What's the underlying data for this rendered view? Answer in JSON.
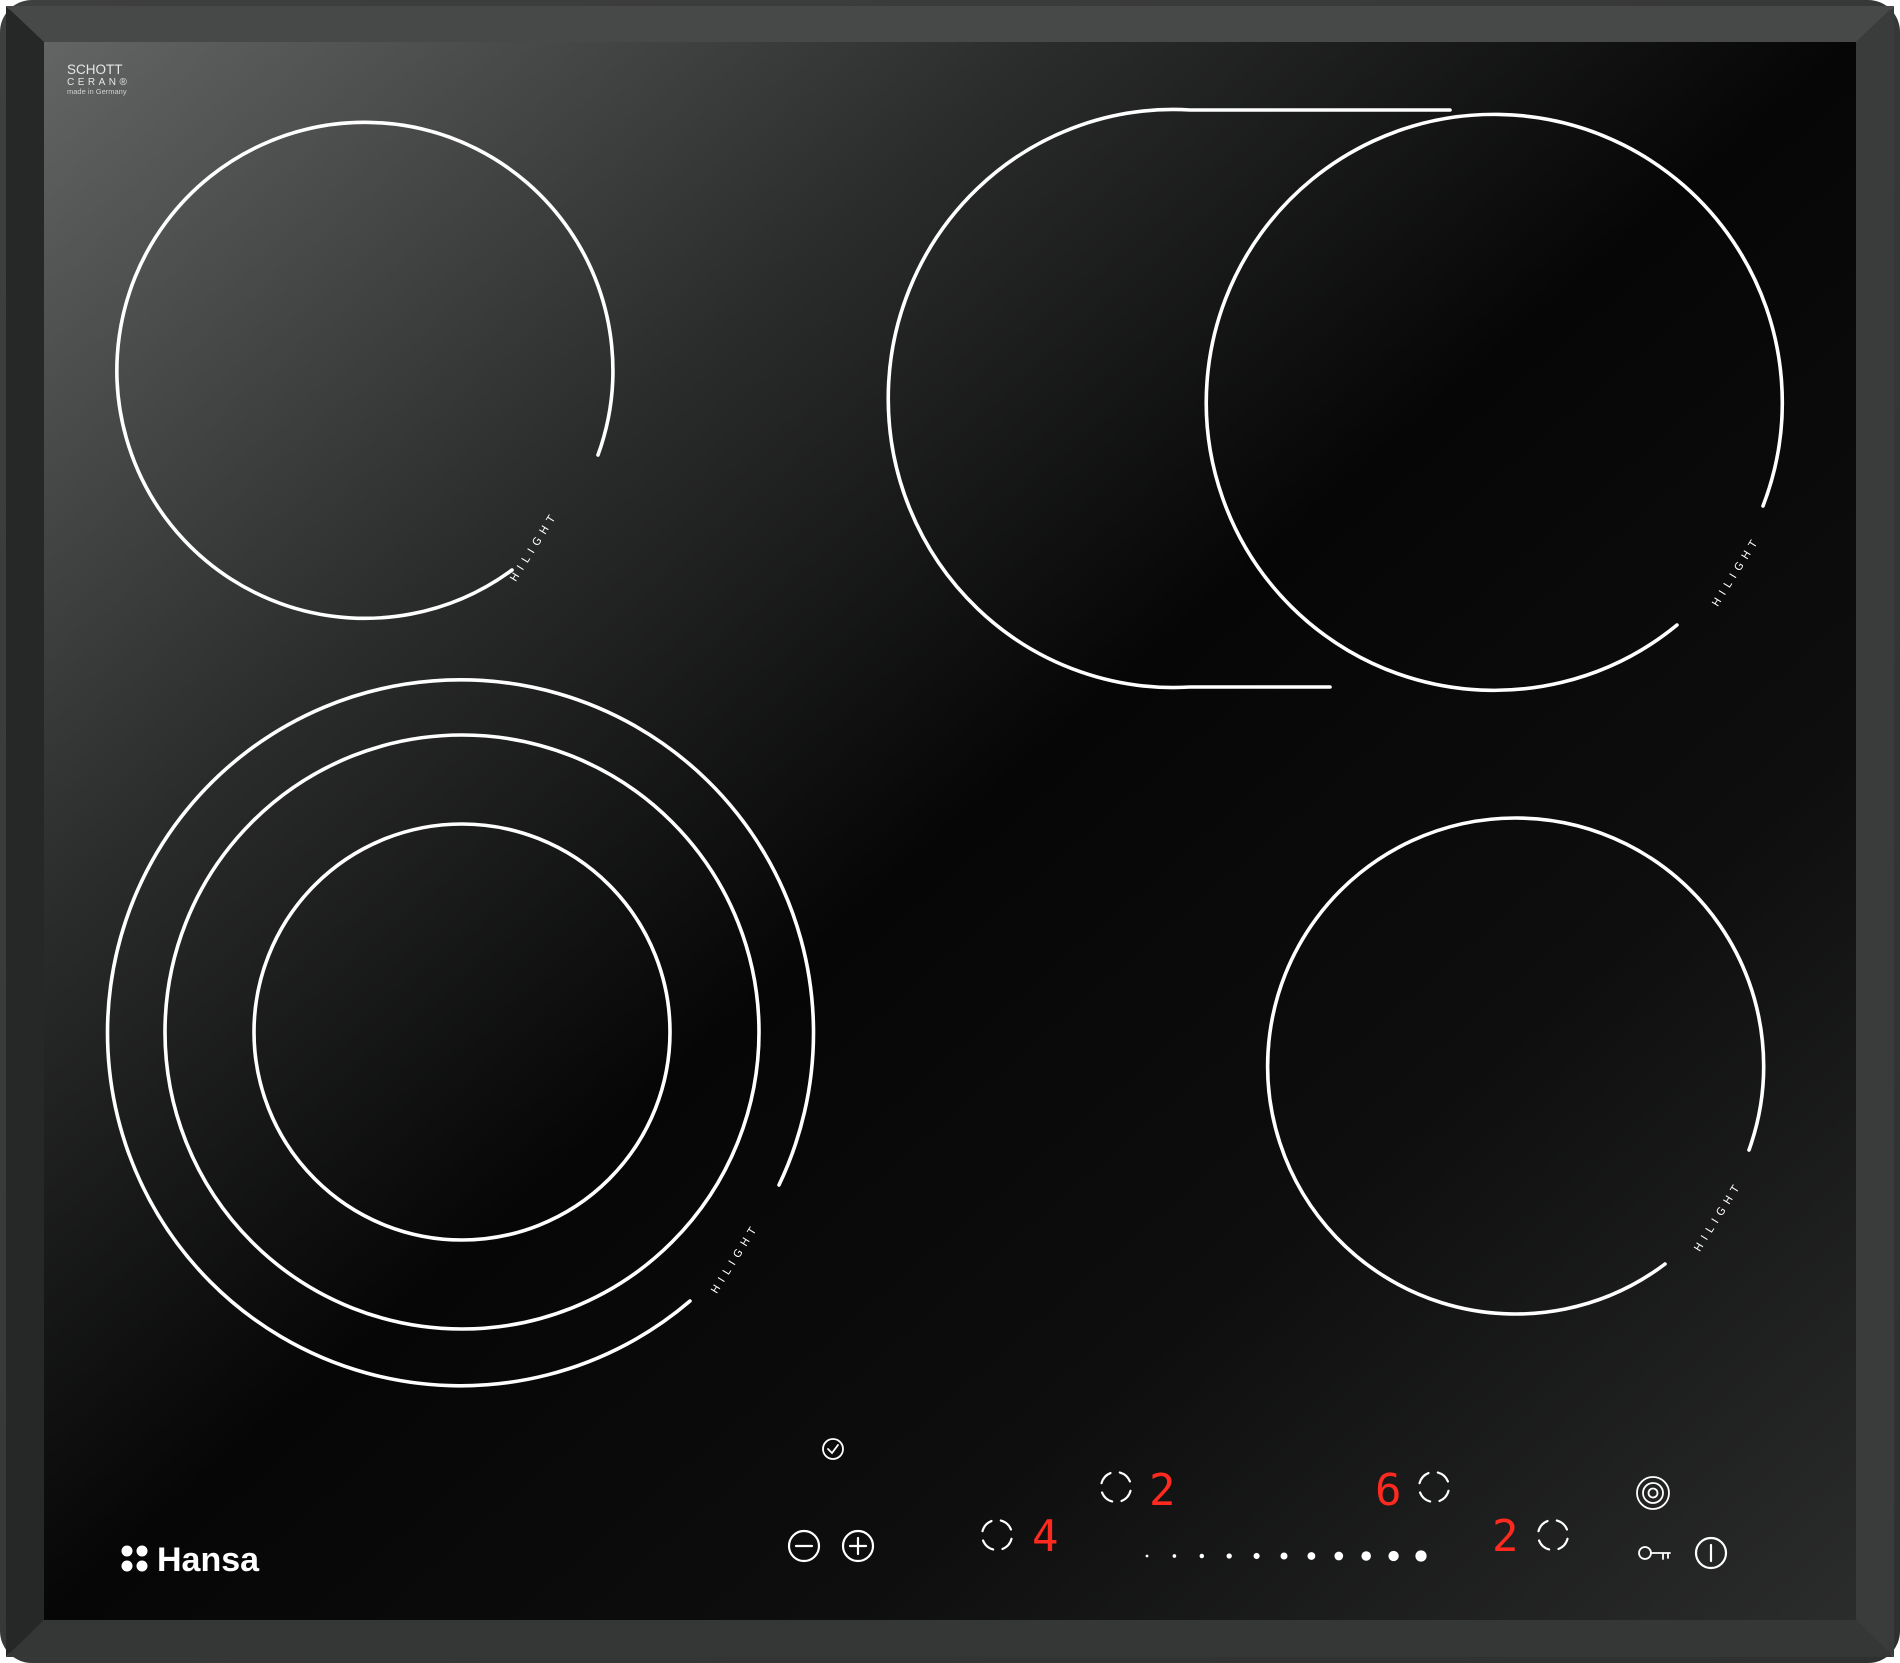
{
  "product": {
    "glass_brand": {
      "line1": "SCHOTT",
      "line2": "CERAN®",
      "line3": "made in Germany"
    },
    "brand": "Hansa",
    "zone_label": "HILIGHT"
  },
  "colors": {
    "glass": "#121212",
    "frame": "#2b2c2c",
    "lines": "#ffffff",
    "display": "#ff2a1f"
  },
  "zones": [
    {
      "name": "rear-left-zone",
      "type": "single"
    },
    {
      "name": "rear-right-zone",
      "type": "oval-extended"
    },
    {
      "name": "front-left-zone",
      "type": "triple-circuit"
    },
    {
      "name": "front-right-zone",
      "type": "single"
    }
  ],
  "controls": {
    "timer_icon": "clock-icon",
    "timer_minus_icon": "minus-icon",
    "timer_plus_icon": "plus-icon",
    "displays": {
      "rear_left": "2",
      "rear_right": "6",
      "front_left": "4",
      "front_right": "2"
    },
    "zone_select_icon": "dashed-circle-icon",
    "slider_steps": 11,
    "extension_icon": "concentric-circles-icon",
    "lock_icon": "key-icon",
    "power_icon": "power-icon"
  }
}
